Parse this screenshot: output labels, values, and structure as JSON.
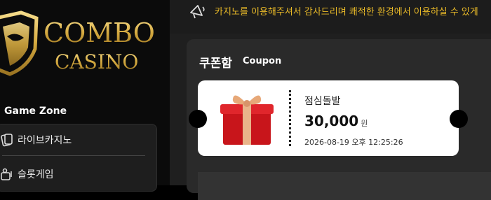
{
  "logo": {
    "line1": "COMBO",
    "line2": "CASINO"
  },
  "sidebar": {
    "section_title": "Game Zone",
    "items": [
      {
        "label": "라이브카지노",
        "icon": "playing-cards-icon"
      },
      {
        "label": "슬롯게임",
        "icon": "slot-machine-icon"
      }
    ]
  },
  "notice": {
    "icon": "megaphone-icon",
    "text": "카지노를 이용해주셔서 감사드리며 쾌적한 환경에서 이용하실 수 있게"
  },
  "coupon_box": {
    "title": "쿠폰함",
    "subtitle": "Coupon",
    "coupon": {
      "name": "점심돌발",
      "amount": "30,000",
      "unit": "원",
      "datetime": "2026-08-19 오후 12:25:26",
      "image": "gift-box-icon"
    }
  },
  "colors": {
    "gold": "#e8b928",
    "panel": "#2a2a2a",
    "card": "#ffffff"
  }
}
